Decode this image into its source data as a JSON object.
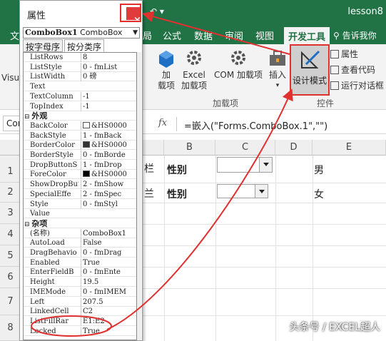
{
  "excel": {
    "title_partial": "lesson8",
    "tabs": [
      "文",
      "局",
      "公式",
      "数据",
      "审阅",
      "视图",
      "开发工具"
    ],
    "active_tab": "开发工具",
    "tell_me": "告诉我你",
    "ribbon": {
      "vis_partial": "Visu",
      "addin_btn": "加\n载项",
      "excel_addin_btn": "Excel\n加载项",
      "com_addin_btn": "COM 加载项",
      "insert_btn": "插入",
      "design_mode_btn": "设计模式",
      "properties": "属性",
      "view_code": "查看代码",
      "run_dialog": "运行对话框",
      "group_addins": "加载项",
      "group_controls": "控件"
    },
    "formula_bar": {
      "name_box": "Con",
      "fx": "fx",
      "formula": "=嵌入(\"Forms.ComboBox.1\",\"\")"
    },
    "columns": [
      "B",
      "C",
      "D",
      "E"
    ],
    "rows": [
      "1",
      "2",
      "3",
      "4",
      "5",
      "6",
      "7",
      "8"
    ],
    "cells": {
      "a1_partial": "栏",
      "a2_partial": "兰",
      "b1": "性别",
      "b2": "性别",
      "e1": "男",
      "e2": "女"
    }
  },
  "properties_window": {
    "title": "属性",
    "close": "×",
    "object": "ComboBox1",
    "object_type": "ComboBox",
    "tabs": [
      "按字母序",
      "按分类序"
    ],
    "rows": [
      {
        "name": "ListRows",
        "value": "8"
      },
      {
        "name": "ListStyle",
        "value": "0 - fmList"
      },
      {
        "name": "ListWidth",
        "value": "0 磅"
      },
      {
        "name": "Text",
        "value": ""
      },
      {
        "name": "TextColumn",
        "value": "-1"
      },
      {
        "name": "TopIndex",
        "value": "-1"
      },
      {
        "name": "外观",
        "value": "",
        "category": true
      },
      {
        "name": "BackColor",
        "value": "&HS0000",
        "swatch": "#ffffff"
      },
      {
        "name": "BackStyle",
        "value": "1 - fmBack"
      },
      {
        "name": "BorderColor",
        "value": "&HS0000",
        "swatch": "#333333"
      },
      {
        "name": "BorderStyle",
        "value": "0 - fmBorde"
      },
      {
        "name": "DropButtonS",
        "value": "1 - fmDrop"
      },
      {
        "name": "ForeColor",
        "value": "&HS0000",
        "swatch": "#000000"
      },
      {
        "name": "ShowDropBut",
        "value": "2 - fmShow"
      },
      {
        "name": "SpecialEffe",
        "value": "2 - fmSpec"
      },
      {
        "name": "Style",
        "value": "0 - fmStyl"
      },
      {
        "name": "Value",
        "value": ""
      },
      {
        "name": "杂项",
        "value": "",
        "category": true
      },
      {
        "name": "(名称)",
        "value": "ComboBox1"
      },
      {
        "name": "AutoLoad",
        "value": "False"
      },
      {
        "name": "DragBehavio",
        "value": "0 - fmDrag"
      },
      {
        "name": "Enabled",
        "value": "True"
      },
      {
        "name": "EnterFieldB",
        "value": "0 - fmEnte"
      },
      {
        "name": "Height",
        "value": "19.5"
      },
      {
        "name": "IMEMode",
        "value": "0 - fmIMEM"
      },
      {
        "name": "Left",
        "value": "207.5"
      },
      {
        "name": "LinkedCell",
        "value": "C2"
      },
      {
        "name": "ListFillRar",
        "value": "E1:E2"
      },
      {
        "name": "Locked",
        "value": "True"
      }
    ]
  },
  "watermark": "头条号 / EXCEL超人",
  "colors": {
    "excel_green": "#217346",
    "highlight_red": "#e03030"
  }
}
